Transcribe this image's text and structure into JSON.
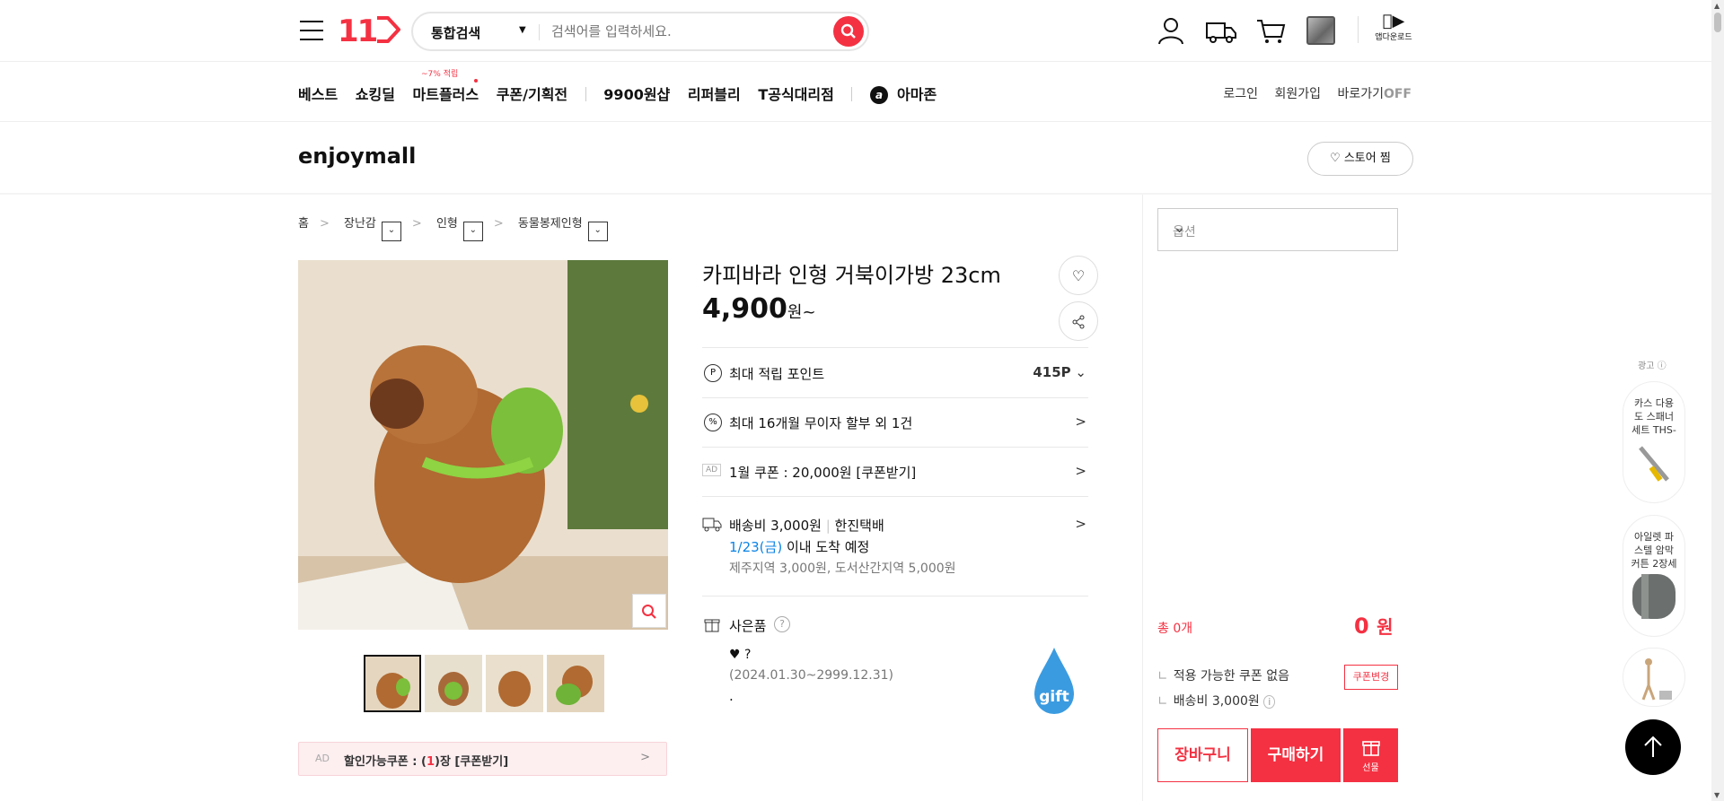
{
  "header": {
    "logo": "11",
    "search_category": "통합검색",
    "search_placeholder": "검색어를 입력하세요.",
    "app_download": "앱다운로드"
  },
  "nav": {
    "items": [
      "베스트",
      "쇼킹딜",
      "마트플러스",
      "쿠폰/기획전",
      "9900원샵",
      "리퍼블리",
      "T공식대리점",
      "아마존"
    ],
    "mart_badge": "~7% 적립",
    "amazon_icon": "a",
    "login": "로그인",
    "signup": "회원가입",
    "shortcut": "바로가기",
    "shortcut_state": "OFF"
  },
  "store": {
    "name": "enjoymall",
    "follow_button": "스토어 찜"
  },
  "breadcrumb": [
    "홈",
    "장난감",
    "인형",
    "동물봉제인형"
  ],
  "product": {
    "title": "카피바라 인형 거북이가방 23cm",
    "price": "4,900",
    "price_suffix": "원~",
    "points_label": "최대 적립 포인트",
    "points_value": "415P",
    "installment": "최대 16개월 무이자 할부 외 1건",
    "coupon_ad": "AD",
    "coupon_text": "1월 쿠폰 : 20,000원 [쿠폰받기]",
    "shipping_fee": "배송비 3,000원",
    "courier": "한진택배",
    "ship_date": "1/23(금)",
    "ship_date_suffix": "이내 도착 예정",
    "ship_extra": "제주지역 3,000원, 도서산간지역 5,000원",
    "gift_label": "사은품",
    "gift_item": "♥ ?",
    "gift_period": "(2024.01.30~2999.12.31)",
    "gift_dot": ".",
    "gift_logo": "gift"
  },
  "coupon_bar": {
    "ad": "AD",
    "prefix": "할인가능쿠폰 : (",
    "count": "1",
    "suffix": ")장 [쿠폰받기]"
  },
  "order": {
    "option_placeholder": "옵션",
    "total_count": "총 0개",
    "total_price": "0",
    "total_unit": "원",
    "coupon_line": "적용 가능한 쿠폰 없음",
    "coupon_change": "쿠폰변경",
    "shipping_line": "배송비 3,000원",
    "cart_button": "장바구니",
    "buy_button": "구매하기",
    "gift_button": "선물"
  },
  "ads": {
    "label": "광고",
    "cards": [
      "카스 다용도 스패너 세트 THS-",
      "아일렛 파스텔 암막 커튼 2장세"
    ]
  },
  "colors": {
    "brand": "#f43142",
    "link_blue": "#0b83e6"
  }
}
